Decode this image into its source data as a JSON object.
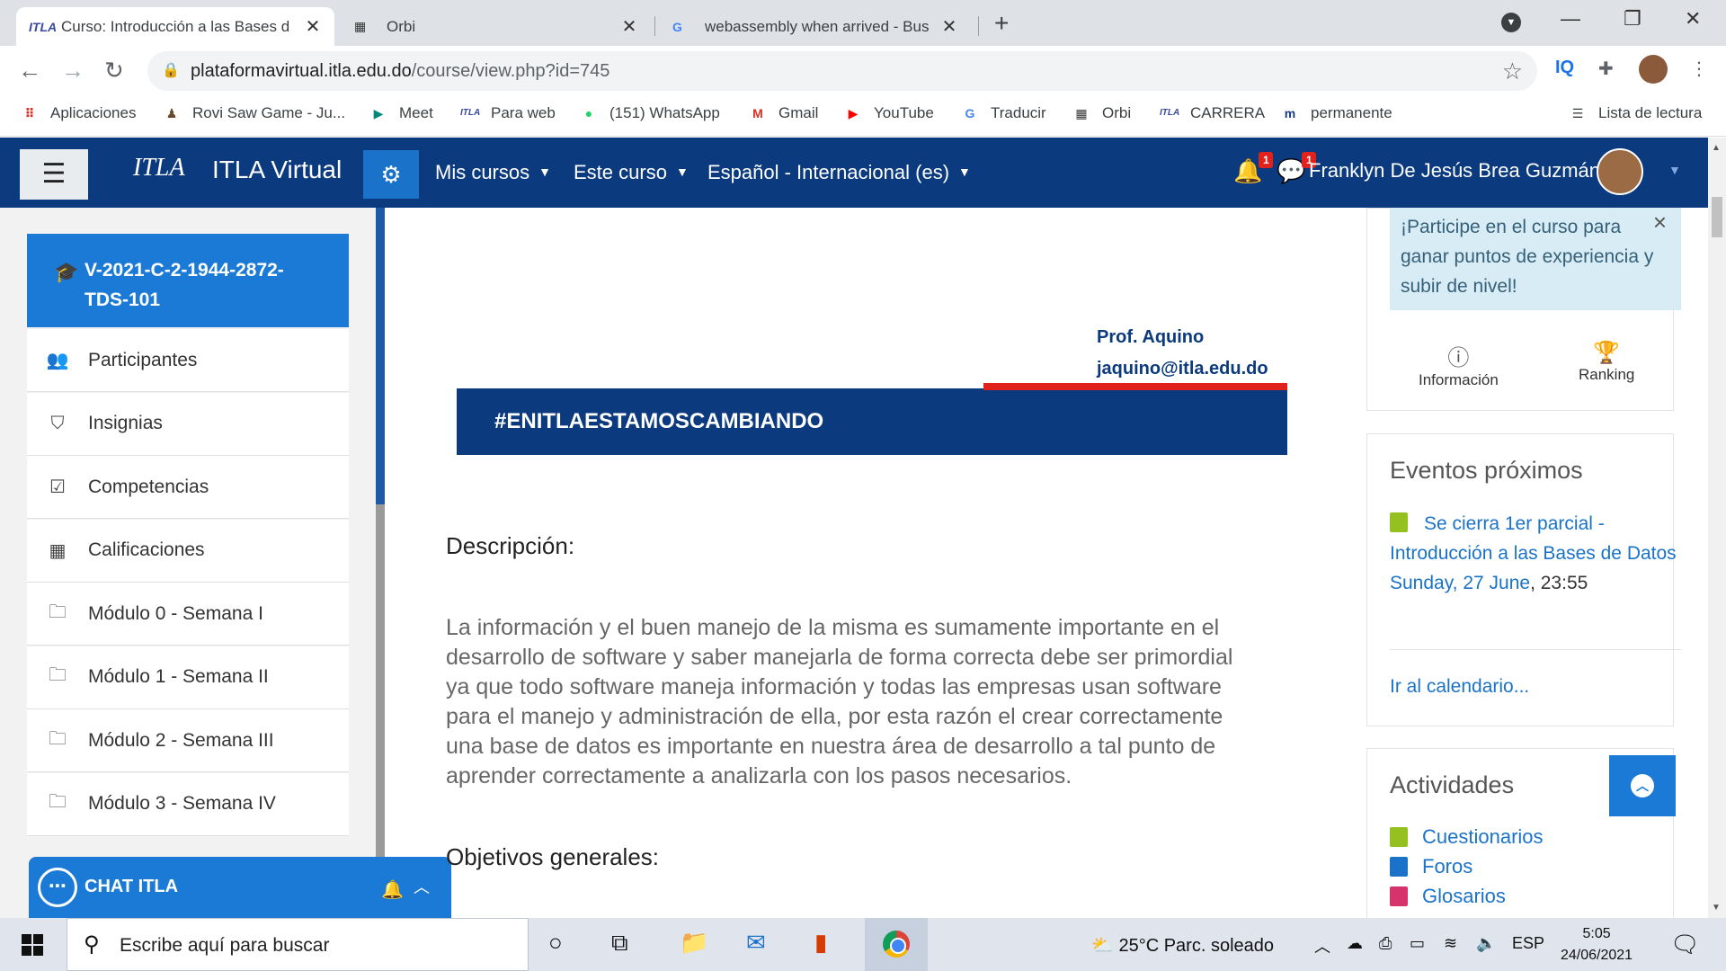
{
  "tabs": [
    {
      "title": "Curso: Introducción a las Bases d",
      "icon": "itla-icon",
      "fav": "ITLA"
    },
    {
      "title": "Orbi",
      "icon": "orbi-icon",
      "fav": "▦"
    },
    {
      "title": "webassembly when arrived - Bus",
      "icon": "google-icon",
      "fav": "G"
    }
  ],
  "address": {
    "domain": "plataformavirtual.itla.edu.do",
    "path": "/course/view.php?id=745"
  },
  "extensions": {
    "iq": "IQ"
  },
  "bookmarks": [
    {
      "label": "Aplicaciones",
      "icon": "apps-grid-icon",
      "glyph": "⠿",
      "color": "#d93025"
    },
    {
      "label": "Rovi Saw Game - Ju...",
      "icon": "rovi-icon",
      "glyph": "♟",
      "color": "#6b4a2b"
    },
    {
      "label": "Meet",
      "icon": "meet-icon",
      "glyph": "▶",
      "color": "#00897b"
    },
    {
      "label": "Para web",
      "icon": "itla-icon",
      "glyph": "ITLA",
      "color": "#3a4aa0"
    },
    {
      "label": "(151) WhatsApp",
      "icon": "whatsapp-icon",
      "glyph": "●",
      "color": "#25d366"
    },
    {
      "label": "Gmail",
      "icon": "gmail-icon",
      "glyph": "M",
      "color": "#d93025"
    },
    {
      "label": "YouTube",
      "icon": "youtube-icon",
      "glyph": "▶",
      "color": "#ff0000"
    },
    {
      "label": "Traducir",
      "icon": "translate-icon",
      "glyph": "G",
      "color": "#4285f4"
    },
    {
      "label": "Orbi",
      "icon": "orbi-icon",
      "glyph": "▦",
      "color": "#333"
    },
    {
      "label": "CARRERA",
      "icon": "itla-icon",
      "glyph": "ITLA",
      "color": "#3a4aa0"
    },
    {
      "label": "permanente",
      "icon": "itla-icon",
      "glyph": "m",
      "color": "#1a3a8a"
    }
  ],
  "reading_list": "Lista de lectura",
  "navbar": {
    "logo": "ITLA",
    "brand": "ITLA Virtual",
    "items": [
      "Mis cursos",
      "Este curso",
      "Español - Internacional (es)"
    ],
    "notif_count": "1",
    "msg_count": "1",
    "user": "Franklyn De Jesús Brea Guzmán"
  },
  "drawer": {
    "course": "V-2021-C-2-1944-2872-TDS-101",
    "items": [
      {
        "label": "Participantes",
        "icon": "users-icon",
        "glyph": "👥"
      },
      {
        "label": "Insignias",
        "icon": "shield-icon",
        "glyph": "⛉"
      },
      {
        "label": "Competencias",
        "icon": "checkbox-icon",
        "glyph": "☑"
      },
      {
        "label": "Calificaciones",
        "icon": "table-icon",
        "glyph": "▦"
      },
      {
        "label": "Módulo 0 - Semana I",
        "icon": "folder-icon",
        "glyph": "🗀"
      },
      {
        "label": "Módulo 1 - Semana II",
        "icon": "folder-icon",
        "glyph": "🗀"
      },
      {
        "label": "Módulo 2 - Semana III",
        "icon": "folder-icon",
        "glyph": "🗀"
      },
      {
        "label": "Módulo 3 - Semana IV",
        "icon": "folder-icon",
        "glyph": "🗀"
      }
    ]
  },
  "chat": {
    "title": "CHAT ITLA"
  },
  "content": {
    "prof_name": "Prof. Aquino",
    "prof_email": "jaquino@itla.edu.do",
    "banner": "#ENITLAESTAMOSCAMBIANDO",
    "desc_heading": "Descripción:",
    "desc_lines": [
      "La información y el buen manejo de la misma es sumamente importante en el",
      "desarrollo de software y saber manejarla de forma correcta debe ser primordial",
      "ya que todo software maneja información y todas las empresas usan software",
      "para el manejo y administración de ella, por esta razón el crear correctamente",
      "una base de datos es importante en nuestra área de desarrollo a tal punto de",
      "aprender correctamente a analizarla con los pasos necesarios."
    ],
    "obj_heading": "Objetivos generales:"
  },
  "right": {
    "alert": "¡Participe en el curso para ganar puntos de experiencia y subir de nivel!",
    "info_label": "Información",
    "ranking_label": "Ranking",
    "events_title": "Eventos próximos",
    "event_link": "Se cierra 1er parcial - Introducción a las Bases de Datos",
    "event_date": "Sunday, 27 June",
    "event_time": ", 23:55",
    "calendar_link": "Ir al calendario...",
    "activities_title": "Actividades",
    "activities": [
      {
        "label": "Cuestionarios",
        "icon": "quiz-icon",
        "color": "#94c11f"
      },
      {
        "label": "Foros",
        "icon": "forum-icon",
        "color": "#1a73c8"
      },
      {
        "label": "Glosarios",
        "icon": "glossary-icon",
        "color": "#d6336c"
      }
    ]
  },
  "taskbar": {
    "search_placeholder": "Escribe aquí para buscar",
    "weather": "25°C  Parc. soleado",
    "lang": "ESP",
    "time": "5:05",
    "date": "24/06/2021"
  }
}
